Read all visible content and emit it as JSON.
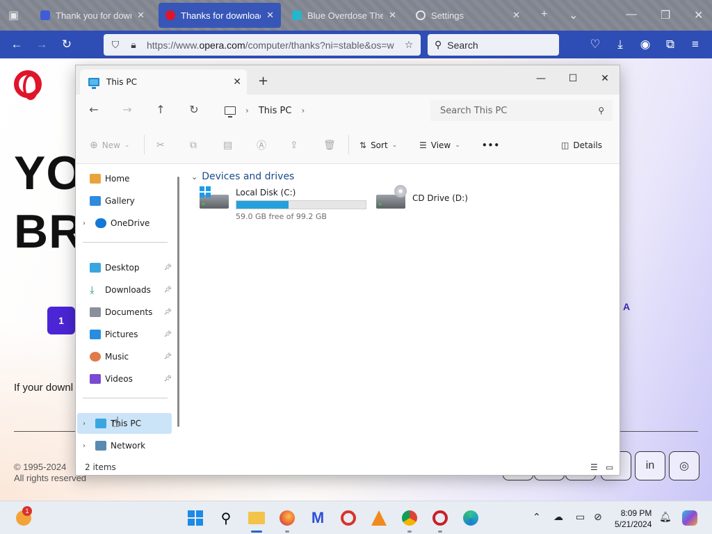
{
  "browser": {
    "tabs": [
      {
        "title": "Thank you for downloa",
        "active": false
      },
      {
        "title": "Thanks for downloadin",
        "active": true
      },
      {
        "title": "Blue Overdose Them",
        "active": false
      },
      {
        "title": "Settings",
        "active": false
      }
    ],
    "url_prefix": "https://www.",
    "url_domain": "opera.com",
    "url_rest": "/computer/thanks?ni=stable&os=w",
    "search_label": "Search"
  },
  "page": {
    "headline_line1": "YO",
    "headline_line2": "BR",
    "step_number": "1",
    "right_letter": "A",
    "download_note": "If your downl",
    "copyright_line1": "© 1995-2024",
    "copyright_line2": "All rights reserved"
  },
  "explorer": {
    "tab_title": "This PC",
    "breadcrumb": "This PC",
    "search_placeholder": "Search This PC",
    "toolbar": {
      "new_label": "New",
      "sort_label": "Sort",
      "view_label": "View",
      "more_label": "•••",
      "details_label": "Details"
    },
    "sidebar": {
      "top": [
        {
          "label": "Home",
          "color": "#e8a43a"
        },
        {
          "label": "Gallery",
          "color": "#2f8be0"
        },
        {
          "label": "OneDrive",
          "color": "#1378d6"
        }
      ],
      "pinned": [
        {
          "label": "Desktop",
          "color": "#3aa6e0"
        },
        {
          "label": "Downloads",
          "color": "#1f9e5a"
        },
        {
          "label": "Documents",
          "color": "#8a9099"
        },
        {
          "label": "Pictures",
          "color": "#2a8ce0"
        },
        {
          "label": "Music",
          "color": "#e07a4a"
        },
        {
          "label": "Videos",
          "color": "#7a4ad0"
        }
      ],
      "bottom": [
        {
          "label": "This PC",
          "selected": true
        },
        {
          "label": "Network",
          "selected": false
        }
      ]
    },
    "group_title": "Devices and drives",
    "drives": [
      {
        "name": "Local Disk (C:)",
        "free_text": "59.0 GB free of 99.2 GB",
        "used_fraction": 0.405
      },
      {
        "name": "CD Drive (D:)"
      }
    ],
    "status_count": "2 items"
  },
  "taskbar": {
    "notification_count": "1",
    "time": "8:09 PM",
    "date": "5/21/2024"
  }
}
